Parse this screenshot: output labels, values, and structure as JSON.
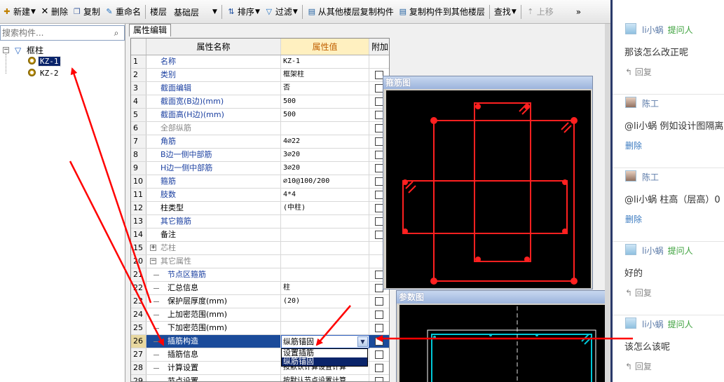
{
  "toolbar": {
    "new_label": "新建",
    "delete_label": "删除",
    "copy_label": "复制",
    "rename_label": "重命名",
    "floor_label": "楼层",
    "floor_value": "基础层",
    "sort_label": "排序",
    "filter_label": "过滤",
    "copy_from_label": "从其他楼层复制构件",
    "copy_to_label": "复制构件到其他楼层",
    "find_label": "查找",
    "moveup_label": "上移",
    "more_label": "»"
  },
  "left": {
    "search_placeholder": "搜索构件...",
    "tree_root": "框柱",
    "tree_items": [
      "KZ-1",
      "KZ-2"
    ]
  },
  "props": {
    "tab_label": "属性编辑",
    "col_num": "",
    "col_name": "属性名称",
    "col_value": "属性值",
    "col_extra": "附加",
    "rows": [
      {
        "num": "1",
        "name": "名称",
        "value": "KZ-1"
      },
      {
        "num": "2",
        "name": "类别",
        "value": "框架柱"
      },
      {
        "num": "3",
        "name": "截面编辑",
        "value": "否"
      },
      {
        "num": "4",
        "name": "截面宽(B边)(mm)",
        "value": "500"
      },
      {
        "num": "5",
        "name": "截面高(H边)(mm)",
        "value": "500"
      },
      {
        "num": "6",
        "name": "全部纵筋",
        "value": ""
      },
      {
        "num": "7",
        "name": "角筋",
        "value": "4⌀22"
      },
      {
        "num": "8",
        "name": "B边一侧中部筋",
        "value": "3⌀20"
      },
      {
        "num": "9",
        "name": "H边一侧中部筋",
        "value": "3⌀20"
      },
      {
        "num": "10",
        "name": "箍筋",
        "value": "⌀10@100/200"
      },
      {
        "num": "11",
        "name": "肢数",
        "value": "4*4"
      },
      {
        "num": "12",
        "name": "柱类型",
        "value": "(中柱)"
      },
      {
        "num": "13",
        "name": "其它箍筋",
        "value": ""
      },
      {
        "num": "14",
        "name": "备注",
        "value": ""
      },
      {
        "num": "15",
        "name": "芯柱",
        "value": ""
      },
      {
        "num": "20",
        "name": "其它属性",
        "value": ""
      },
      {
        "num": "21",
        "name": "节点区箍筋",
        "value": ""
      },
      {
        "num": "22",
        "name": "汇总信息",
        "value": "柱"
      },
      {
        "num": "23",
        "name": "保护层厚度(mm)",
        "value": "(20)"
      },
      {
        "num": "24",
        "name": "上加密范围(mm)",
        "value": ""
      },
      {
        "num": "25",
        "name": "下加密范围(mm)",
        "value": ""
      },
      {
        "num": "26",
        "name": "插筋构造",
        "value": "纵筋锚固"
      },
      {
        "num": "27",
        "name": "插筋信息",
        "value": ""
      },
      {
        "num": "28",
        "name": "计算设置",
        "value": "按默认计算设置计算"
      },
      {
        "num": "29",
        "name": "节点设置",
        "value": "按默认节点设置计算"
      }
    ],
    "dropdown_options": [
      "设置插筋",
      "纵筋锚固"
    ]
  },
  "panels": {
    "rebar_title": "箍筋图",
    "param_title": "参数图"
  },
  "comments": [
    {
      "user": "li小蜗",
      "tag": "提问人",
      "text": "那该怎么改正呢",
      "action": "回复"
    },
    {
      "user": "陈工",
      "tag": "",
      "text": "@li小蜗 例如设计图隔离",
      "action": "删除"
    },
    {
      "user": "陈工",
      "tag": "",
      "text": "@li小蜗 柱高（层高）0",
      "action": "删除"
    },
    {
      "user": "li小蜗",
      "tag": "提问人",
      "text": "好的",
      "action": "回复"
    },
    {
      "user": "li小蜗",
      "tag": "提问人",
      "text": "该怎么该呢",
      "action": "回复"
    }
  ],
  "colors": {
    "selection": "#1b4b9a",
    "annotation_red": "#ff0000",
    "rebar_red": "#ff2020",
    "value_header": "#c06000",
    "asker_green": "#3aa03a"
  }
}
